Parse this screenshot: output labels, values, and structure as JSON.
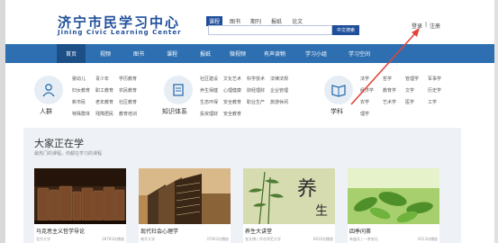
{
  "header": {
    "logo_cn": "济宁市民学习中心",
    "logo_en": "Jining Civic Learning Center"
  },
  "search": {
    "tabs": [
      "课程",
      "图书",
      "期刊",
      "报纸",
      "论文"
    ],
    "button": "中文搜索",
    "placeholder": ""
  },
  "user": {
    "login": "登录",
    "sep": "|",
    "register": "注册"
  },
  "nav": {
    "items": [
      "首页",
      "视频",
      "图书",
      "课程",
      "报纸",
      "微视频",
      "有声读物",
      "学习小组",
      "学习空间"
    ]
  },
  "categories": {
    "people": {
      "label": "人群",
      "items": [
        "婴幼儿",
        "青少年",
        "学历教育",
        "妇女教育",
        "职工教育",
        "农民教育",
        "新市民",
        "老年教育",
        "社区教育",
        "特殊群体",
        "残障居民",
        "教育培训"
      ]
    },
    "knowledge": {
      "label": "知识体系",
      "items": [
        "社区建设",
        "文化艺术",
        "科学技术",
        "法律法规",
        "养生保健",
        "心理健康",
        "财经理财",
        "企业管理",
        "生态环保",
        "安全教育",
        "职业生产",
        "旅游休闲",
        "投资理财",
        "安全教育"
      ]
    },
    "subjects": {
      "label": "学科",
      "items": [
        "法学",
        "哲学",
        "管理学",
        "军事学",
        "经济学",
        "教育学",
        "文学",
        "历史学",
        "农学",
        "艺术学",
        "医学",
        "工学",
        "理学"
      ]
    }
  },
  "section": {
    "title": "大家正在学",
    "subtitle": "最热门的课程，你都在学习的课程",
    "cards": [
      {
        "title": "马克思主义哲学导论",
        "source": "北京大学",
        "views": "28783次播放"
      },
      {
        "title": "现代社会心理学",
        "source": "南开大学",
        "views": "37063次播放"
      },
      {
        "title": "养生大讲堂",
        "source": "张文博 | 华东师范大学",
        "views": "6616次播放"
      },
      {
        "title": "四季问茶",
        "source": "朱盛兵 | 一茶农社",
        "views": "4013次播放"
      }
    ],
    "card3_calligraphy": "养生"
  }
}
